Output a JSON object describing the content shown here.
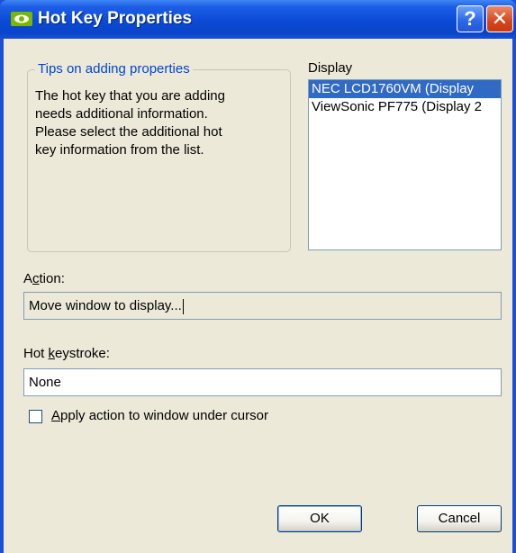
{
  "window": {
    "title": "Hot Key Properties",
    "help_label": "?",
    "close_label": "✕"
  },
  "tips": {
    "legend": "Tips on adding properties",
    "lines": [
      "The hot key that you are adding",
      "needs additional information.",
      "Please select the additional hot",
      "key information from the list."
    ]
  },
  "display": {
    "label": "Display",
    "items": [
      "NEC LCD1760VM (Display",
      "ViewSonic PF775 (Display 2"
    ],
    "selected_index": 0
  },
  "action": {
    "label_prefix": "A",
    "label_mnemonic": "c",
    "label_suffix": "tion:",
    "value": "Move window to display..."
  },
  "hotkey": {
    "label_prefix": "Hot ",
    "label_mnemonic": "k",
    "label_suffix": "eystroke:",
    "value": "None"
  },
  "apply": {
    "label_mnemonic": "A",
    "label_suffix": "pply action to window under cursor",
    "checked": false
  },
  "buttons": {
    "ok": "OK",
    "cancel": "Cancel"
  },
  "colors": {
    "titlebar": "#0a4ad6",
    "client": "#ece9d8",
    "selection": "#316ac5",
    "legend_text": "#0046d5"
  }
}
